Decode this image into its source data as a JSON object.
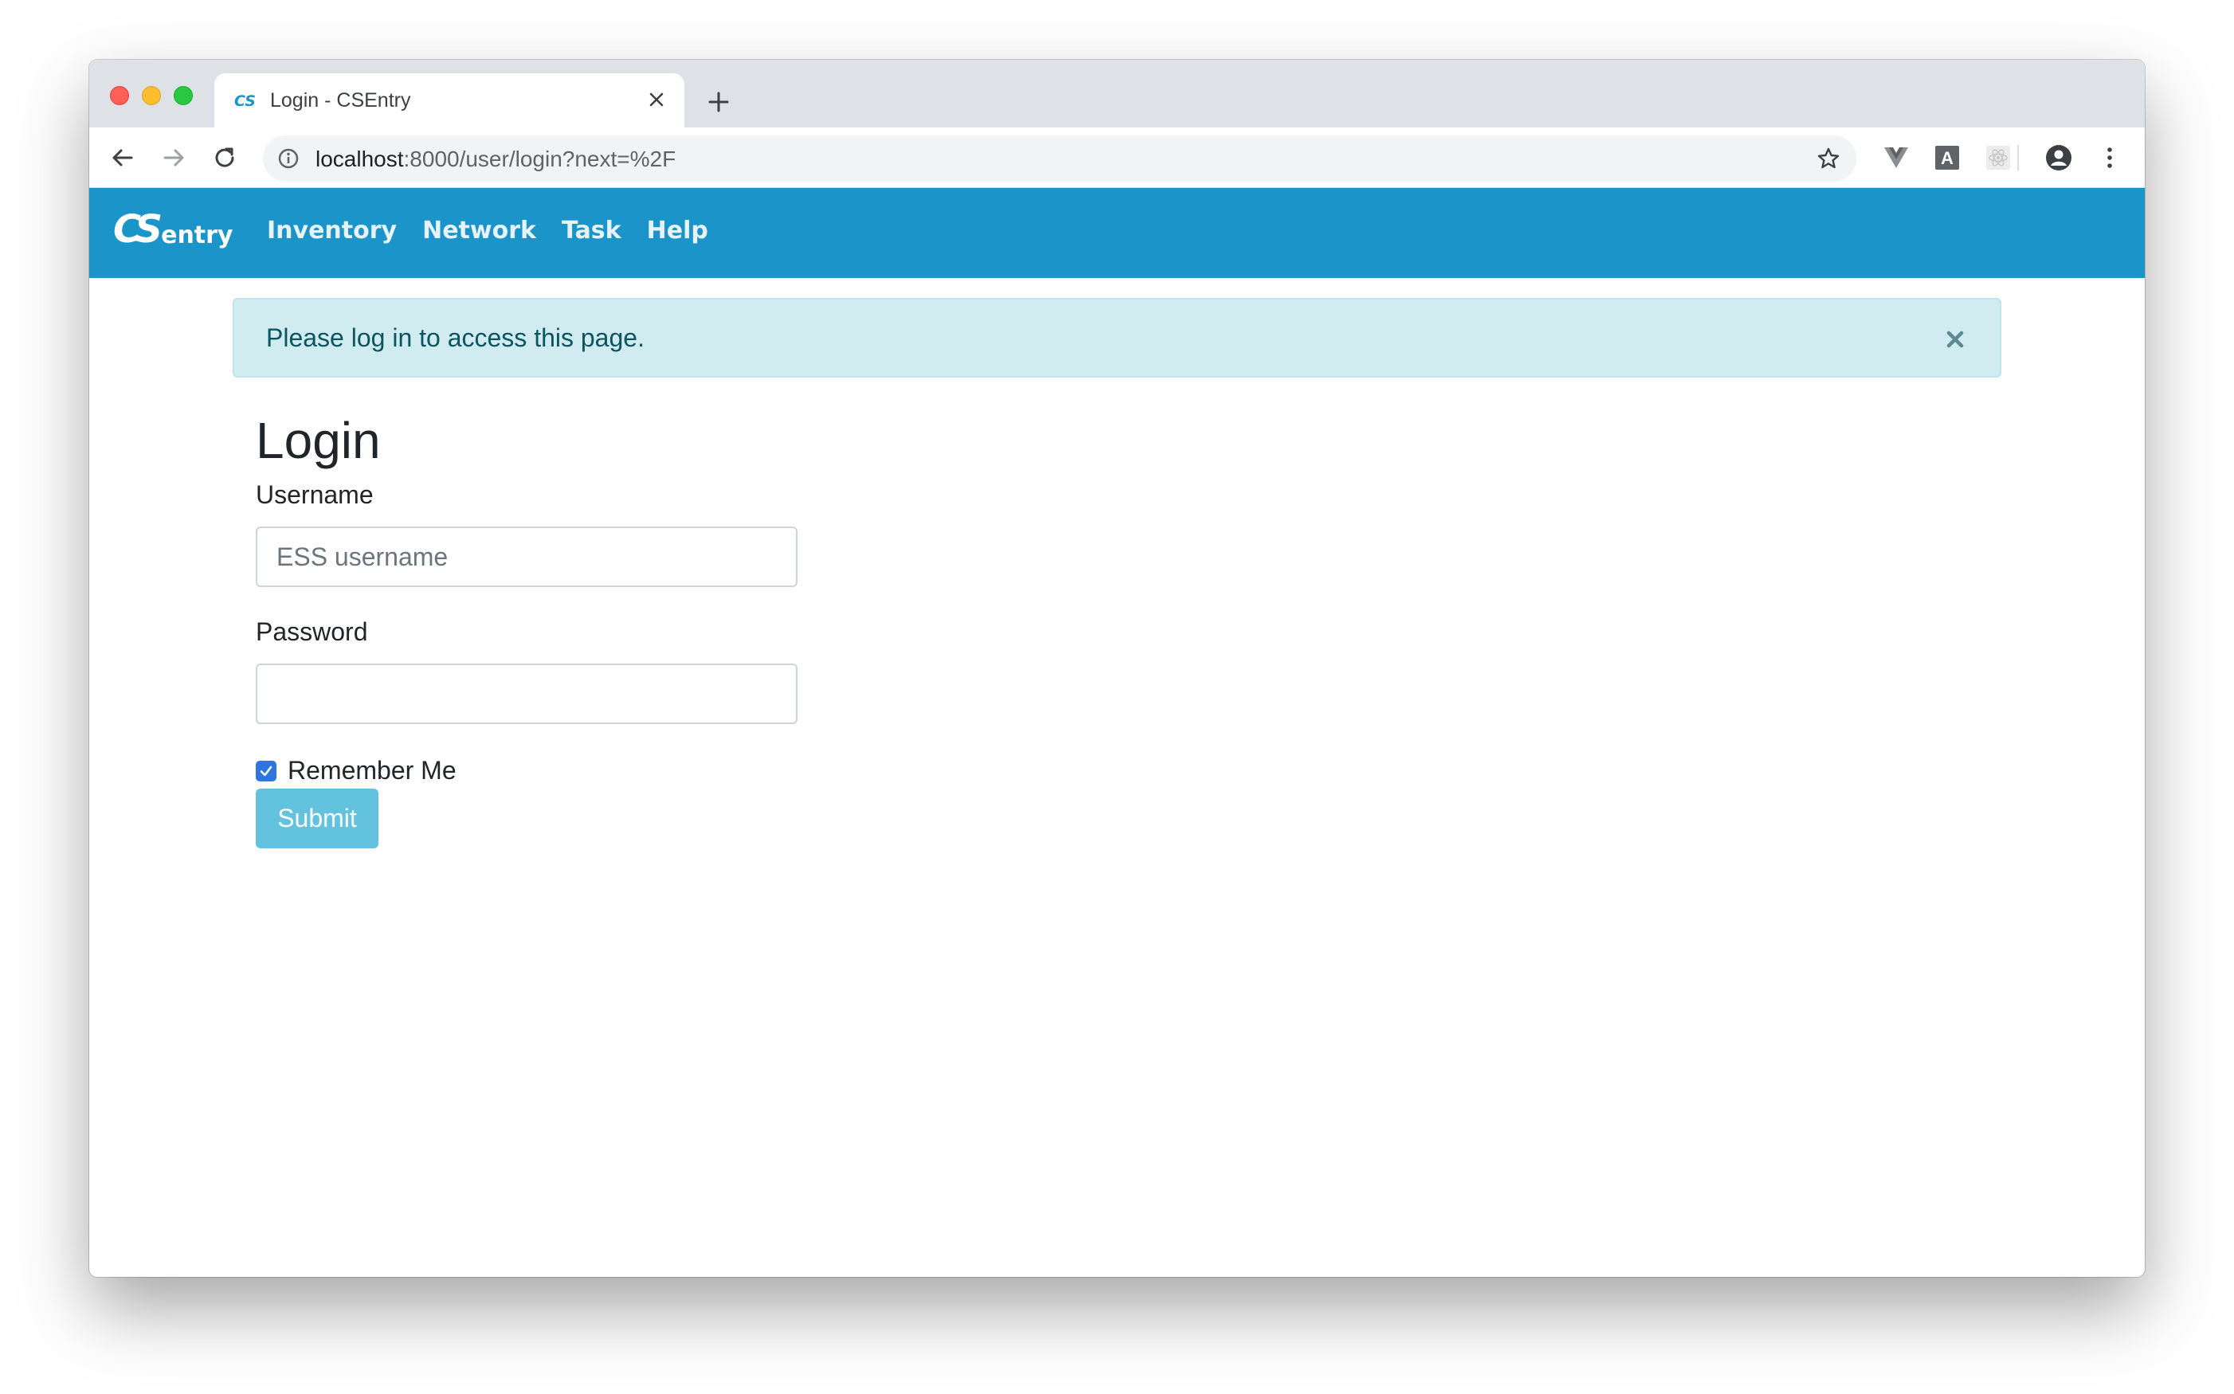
{
  "browser": {
    "tab_title": "Login - CSEntry",
    "favicon_text": "CS",
    "url_host": "localhost",
    "url_path": ":8000/user/login?next=%2F",
    "extensions": [
      "vue-devtools-icon",
      "a-extension-icon",
      "react-devtools-icon"
    ]
  },
  "navbar": {
    "brand_cs": "CS",
    "brand_entry": "entry",
    "links": [
      "Inventory",
      "Network",
      "Task",
      "Help"
    ],
    "color": "#1a94c9"
  },
  "alert": {
    "message": "Please log in to access this page.",
    "close_symbol": "×"
  },
  "form": {
    "title": "Login",
    "username_label": "Username",
    "username_placeholder": "ESS username",
    "username_value": "",
    "password_label": "Password",
    "password_value": "",
    "remember_label": "Remember Me",
    "remember_checked": true,
    "submit_label": "Submit"
  }
}
